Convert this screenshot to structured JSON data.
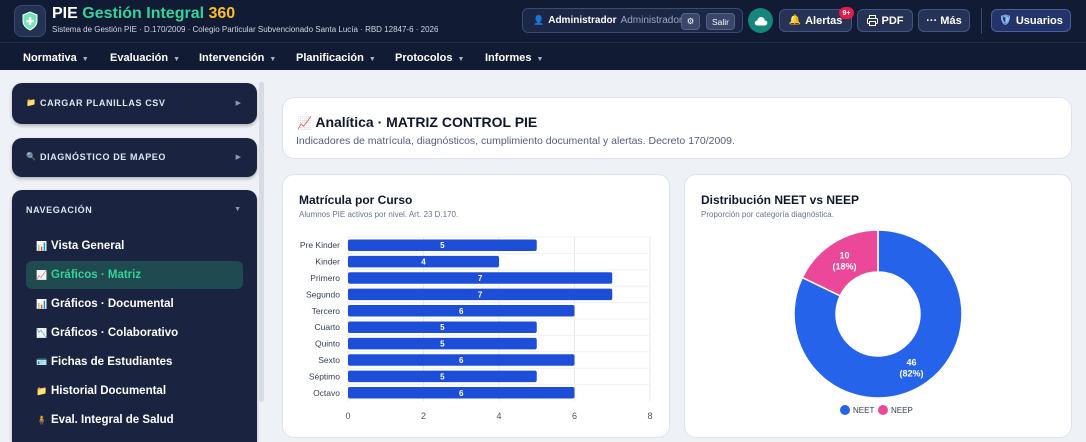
{
  "header": {
    "brand_pie": "PIE",
    "brand_gestion": "Gestión Integral",
    "brand_version": "360",
    "subtitle": "Sistema de Gestión PIE · D.170/2009 · Colegio Particular Subvencionado Santa Lucía · RBD 12847-6 · 2026",
    "user_role": "Administrador",
    "user_name": "Administrador",
    "settings_label": "⚙",
    "logout_label": "Salir",
    "alerts_label": "Alertas",
    "alerts_badge": "9+",
    "pdf_label": "PDF",
    "more_label": "··· Más",
    "users_label": "Usuarios"
  },
  "nav": [
    {
      "label": "Normativa"
    },
    {
      "label": "Evaluación"
    },
    {
      "label": "Intervención"
    },
    {
      "label": "Planificación"
    },
    {
      "label": "Protocolos"
    },
    {
      "label": "Informes"
    }
  ],
  "sidebar": {
    "csv_label": "CARGAR PLANILLAS CSV",
    "mapping_label": "DIAGNÓSTICO DE MAPEO",
    "nav_heading": "NAVEGACIÓN",
    "items": [
      {
        "label": "Vista General",
        "icon": "📊"
      },
      {
        "label": "Gráficos · Matriz",
        "icon": "📈"
      },
      {
        "label": "Gráficos · Documental",
        "icon": "📊"
      },
      {
        "label": "Gráficos · Colaborativo",
        "icon": "📉"
      },
      {
        "label": "Fichas de Estudiantes",
        "icon": "🪪"
      },
      {
        "label": "Historial Documental",
        "icon": "📁"
      },
      {
        "label": "Eval. Integral de Salud",
        "icon": "🧍"
      }
    ]
  },
  "main": {
    "title": "Analítica · MATRIZ CONTROL PIE",
    "title_icon": "📈",
    "subtitle": "Indicadores de matrícula, diagnósticos, cumplimiento documental y alertas. Decreto 170/2009."
  },
  "chart_data": [
    {
      "type": "bar",
      "orientation": "horizontal",
      "title": "Matrícula por Curso",
      "subtitle": "Alumnos PIE activos por nivel. Art. 23 D.170.",
      "categories": [
        "Pre Kinder",
        "Kinder",
        "Primero",
        "Segundo",
        "Tercero",
        "Cuarto",
        "Quinto",
        "Sexto",
        "Séptimo",
        "Octavo"
      ],
      "values": [
        5,
        4,
        7,
        7,
        6,
        5,
        5,
        6,
        5,
        6
      ],
      "xlim": [
        0,
        8
      ],
      "xticks": [
        0,
        2,
        4,
        6,
        8
      ],
      "color": "#1d4ed8",
      "grid": true
    },
    {
      "type": "pie",
      "donut": true,
      "title": "Distribución NEET vs NEEP",
      "subtitle": "Proporción por categoría diagnóstica.",
      "slices": [
        {
          "label": "NEET",
          "value": 46,
          "percent": "(82%)",
          "color": "#2563eb"
        },
        {
          "label": "NEEP",
          "value": 10,
          "percent": "(18%)",
          "color": "#ec4899"
        }
      ],
      "legend": "bottom"
    }
  ]
}
